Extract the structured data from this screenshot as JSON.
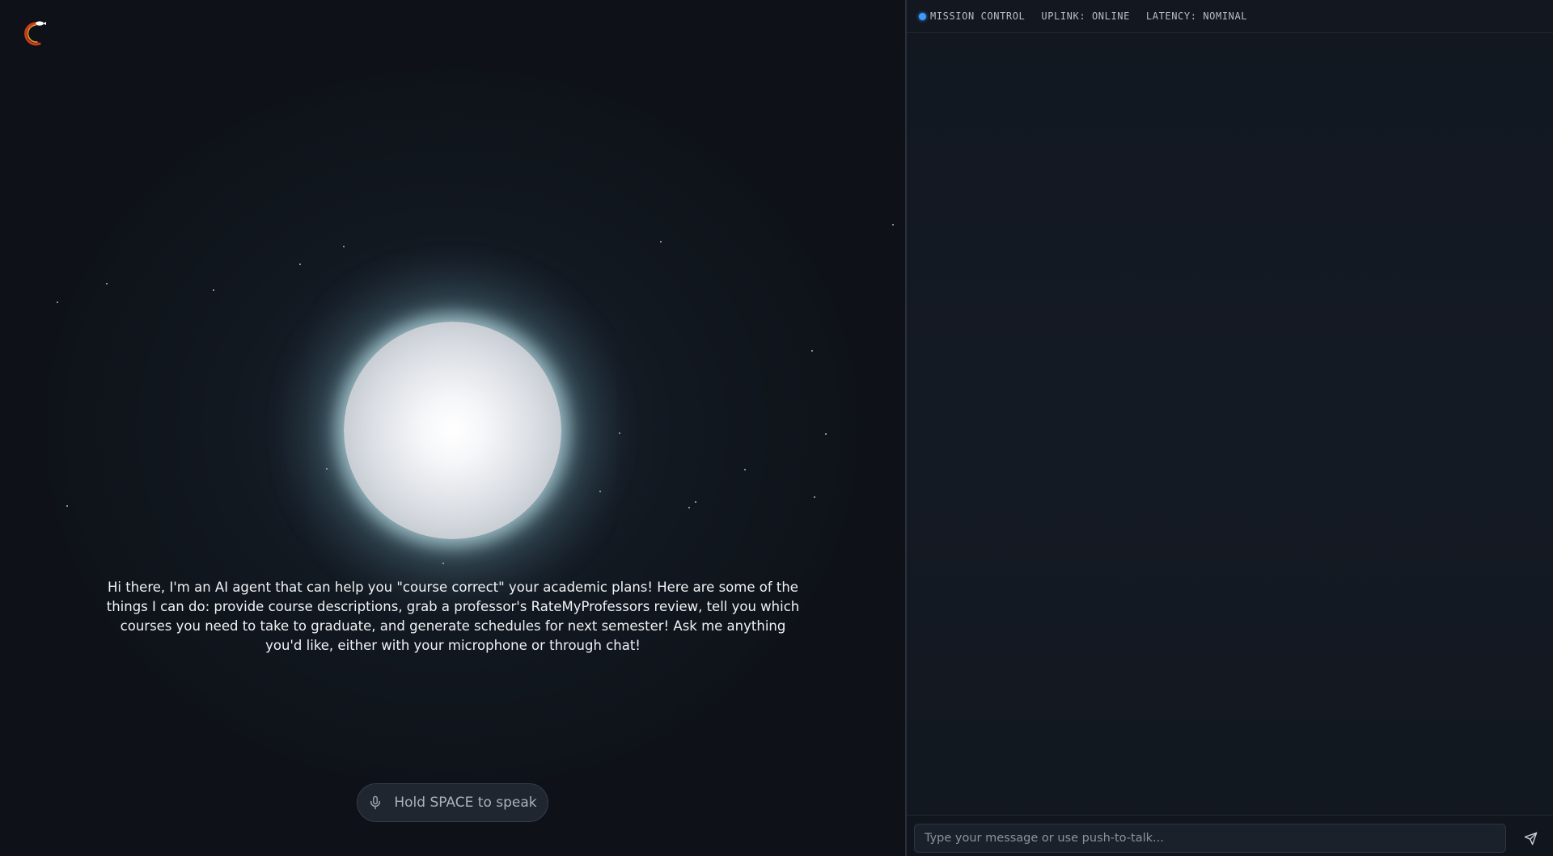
{
  "app": {
    "logo_icon": "rocket-crescent-logo-icon",
    "accent_color": "#3b9cff"
  },
  "hero": {
    "intro_text": "Hi there, I'm an AI agent that can help you \"course correct\" your academic plans! Here are some of the things I can do: provide course descriptions, grab a professor's RateMyProfessors review, tell you which courses you need to take to graduate, and generate schedules for next semester! Ask me anything you'd like, either with your microphone or through chat!",
    "push_to_talk_label": "Hold SPACE to speak",
    "push_to_talk_icon": "microphone-icon"
  },
  "status_bar": {
    "indicator_color": "#3b9cff",
    "title": "MISSION CONTROL",
    "uplink": "UPLINK: ONLINE",
    "latency": "LATENCY: NOMINAL"
  },
  "chat": {
    "input_value": "",
    "input_placeholder": "Type your message or use push-to-talk...",
    "send_icon": "send-icon"
  }
}
